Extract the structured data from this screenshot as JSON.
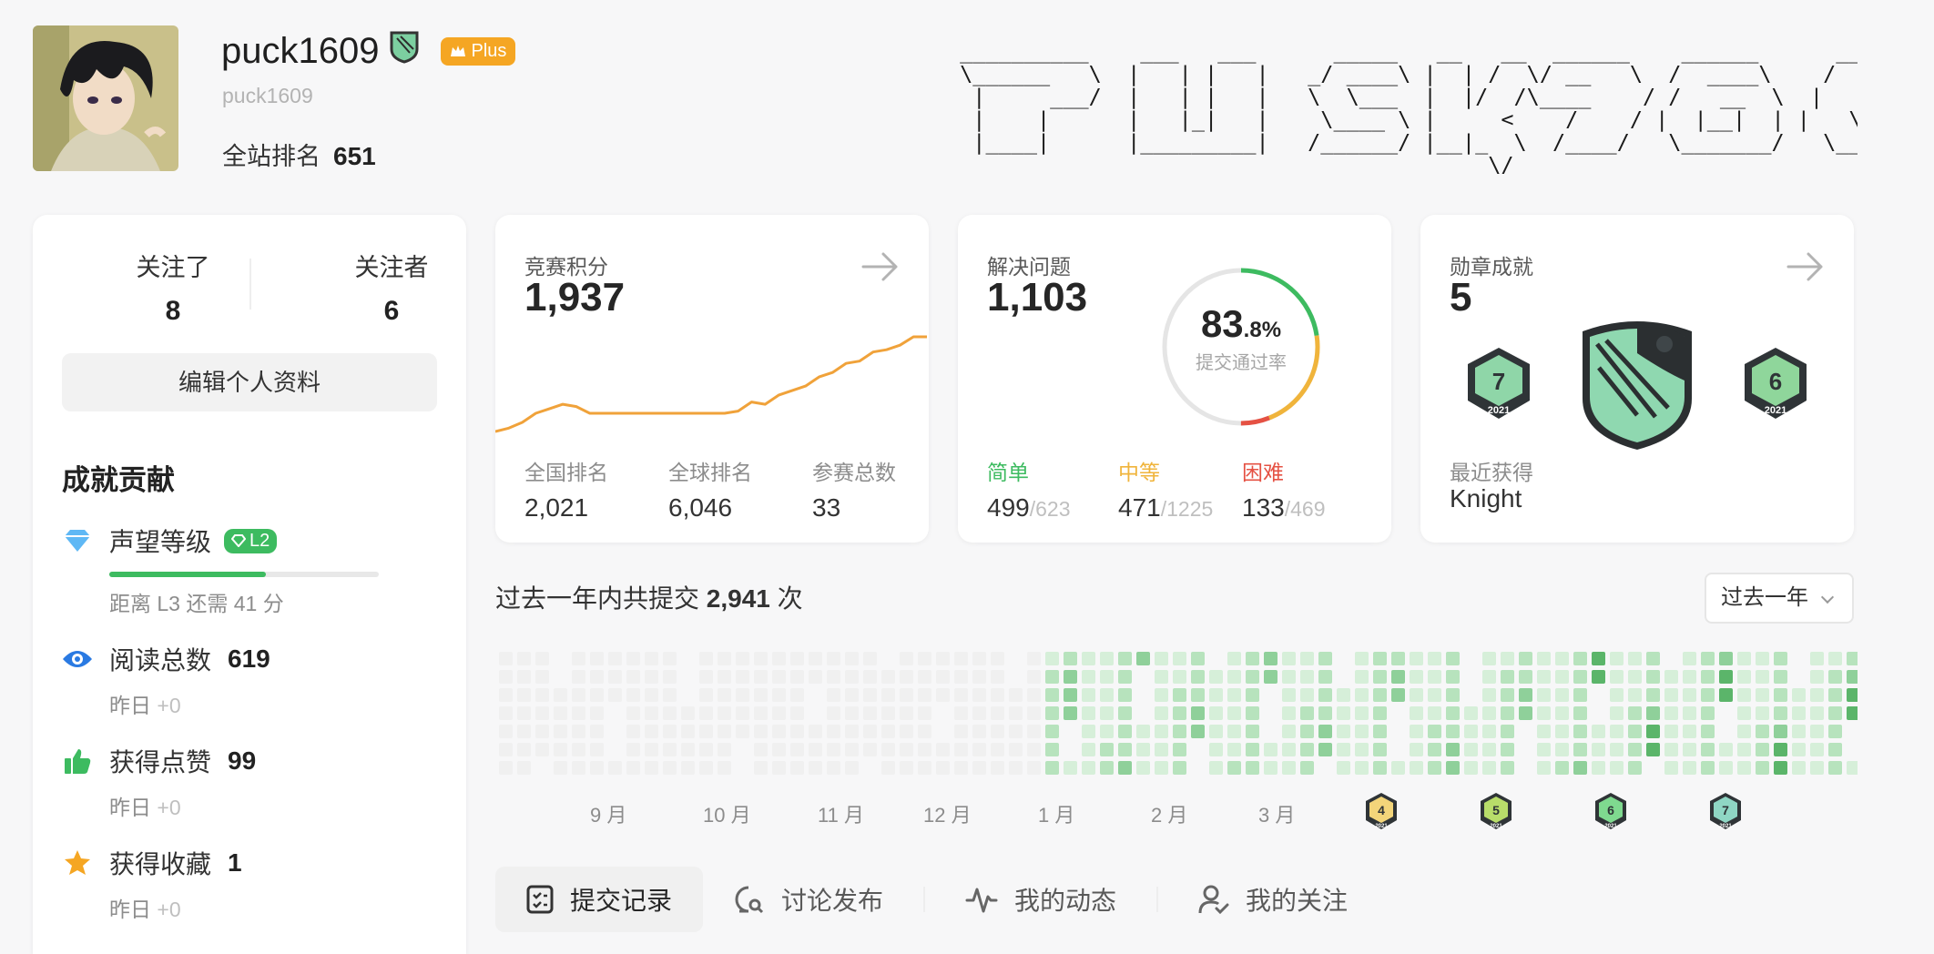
{
  "user": {
    "username": "puck1609",
    "handle": "puck1609",
    "plus_label": "Plus",
    "rank_label": "全站排名",
    "rank_value": "651"
  },
  "banner_ascii": [
    " __________    ___   ___      _____   __   __  ______    ______      ________    ________",
    " \\______   \\  |   | |   |   _/ ____\\ |  | /  \\/ __   \\  /  ____\\    /   __   \\  /   __   \\",
    "  |     ___/  |   | |   |   \\  \\___  |  |/  /\\____    / /   __  \\  |   /  \\   | \\____    /",
    "  |    |      |   |_|   |    \\____ \\ |     <    /    / |  |__|  | |   \\__/   |    /    /",
    "  |____|      |_________|   /______/ |__|_  \\  /____/   \\_______/   \\________/   /____/",
    "                                          \\/"
  ],
  "follow": {
    "following_label": "关注了",
    "following_value": "8",
    "followers_label": "关注者",
    "followers_value": "6"
  },
  "edit_profile_label": "编辑个人资料",
  "achievements": {
    "title": "成就贡献",
    "reputation_label": "声望等级",
    "reputation_badge": "L2",
    "reputation_progress": 0.58,
    "reputation_note": "距离 L3 还需 41 分",
    "reads_label": "阅读总数",
    "reads_value": "619",
    "reads_delta_label": "昨日",
    "reads_delta": "+0",
    "likes_label": "获得点赞",
    "likes_value": "99",
    "likes_delta_label": "昨日",
    "likes_delta": "+0",
    "favs_label": "获得收藏",
    "favs_value": "1",
    "favs_delta_label": "昨日",
    "favs_delta": "+0"
  },
  "contest": {
    "label": "竞赛积分",
    "value": "1,937",
    "national_rank_label": "全国排名",
    "national_rank": "2,021",
    "global_rank_label": "全球排名",
    "global_rank": "6,046",
    "attended_label": "参赛总数",
    "attended": "33",
    "trend": [
      1520,
      1535,
      1560,
      1600,
      1620,
      1640,
      1630,
      1600,
      1600,
      1600,
      1600,
      1600,
      1600,
      1600,
      1600,
      1600,
      1600,
      1600,
      1610,
      1650,
      1640,
      1680,
      1700,
      1720,
      1760,
      1780,
      1820,
      1830,
      1870,
      1880,
      1900,
      1937,
      1937
    ]
  },
  "solved": {
    "label": "解决问题",
    "value": "1,103",
    "rate_int": "83",
    "rate_dec": ".8%",
    "rate_label": "提交通过率",
    "easy_label": "简单",
    "easy": "499",
    "easy_total": "/623",
    "medium_label": "中等",
    "medium": "471",
    "medium_total": "/1225",
    "hard_label": "困难",
    "hard": "133",
    "hard_total": "/469",
    "colors": {
      "easy": "#3dbb60",
      "medium": "#f0b43b",
      "hard": "#e55143"
    }
  },
  "badges": {
    "label": "勋章成就",
    "value": "5",
    "recent_label": "最近获得",
    "recent": "Knight",
    "small_left": "7",
    "small_right": "6",
    "year": "2021"
  },
  "submissions": {
    "caption_prefix": "过去一年内共提交",
    "count": "2,941",
    "caption_suffix": "次",
    "period": "过去一年",
    "months": [
      "9 月",
      "10 月",
      "11 月",
      "12 月",
      "1 月",
      "2 月",
      "3 月"
    ],
    "month_badges": [
      "4",
      "5",
      "6",
      "7"
    ],
    "badge_year": "2021"
  },
  "tabs": [
    "提交记录",
    "讨论发布",
    "我的动态",
    "我的关注"
  ]
}
